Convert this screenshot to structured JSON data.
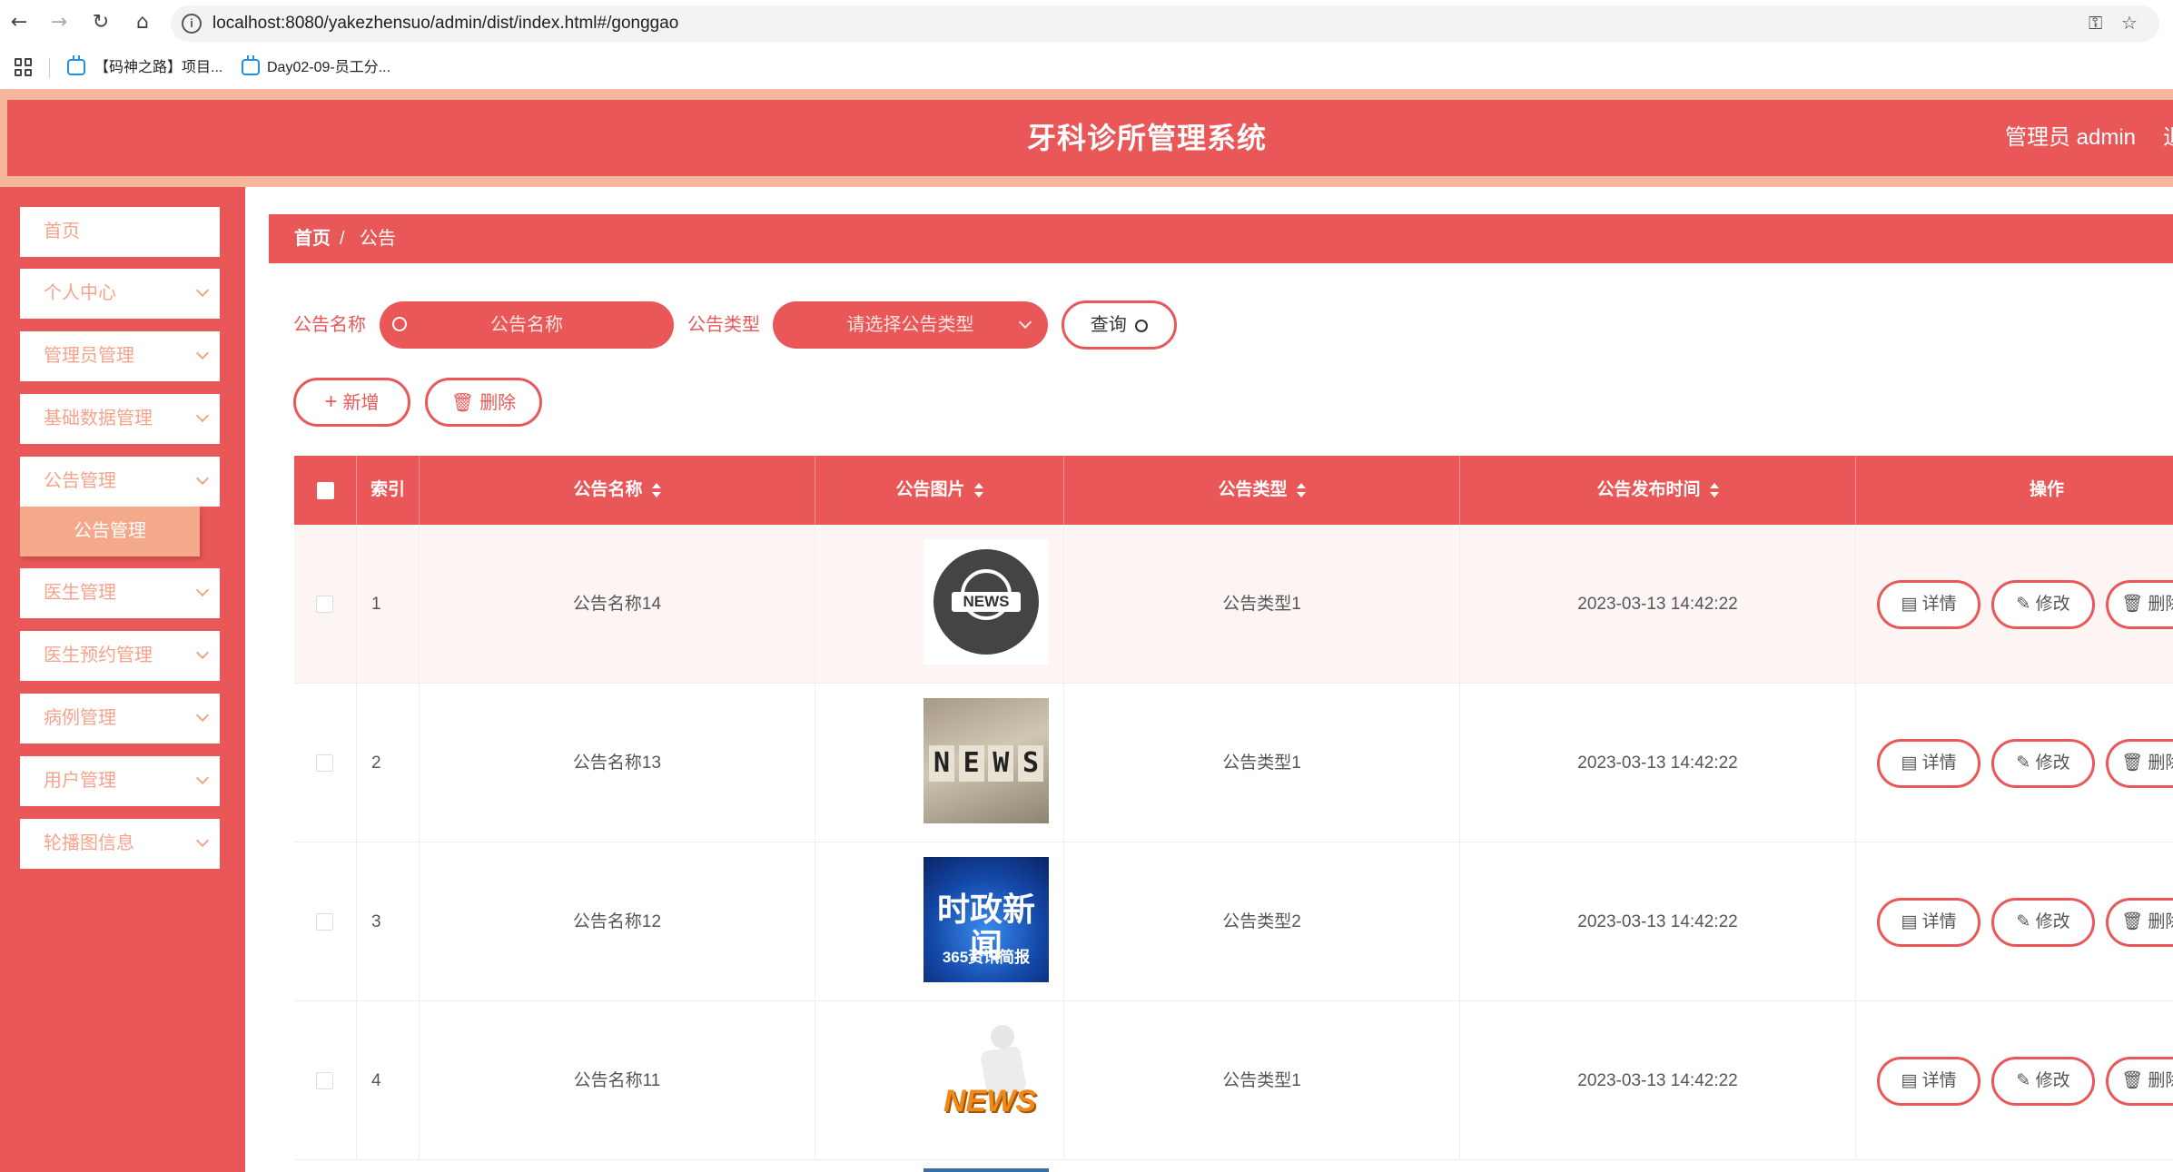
{
  "browser": {
    "url": "localhost:8080/yakezhensuo/admin/dist/index.html#/gonggao",
    "bookmarks": [
      "【码神之路】项目...",
      "Day02-09-员工分..."
    ]
  },
  "header": {
    "title": "牙科诊所管理系统",
    "user": "管理员 admin",
    "logout_partial": "退"
  },
  "sidebar": {
    "items": [
      {
        "label": "首页"
      },
      {
        "label": "个人中心"
      },
      {
        "label": "管理员管理"
      },
      {
        "label": "基础数据管理"
      },
      {
        "label": "公告管理"
      },
      {
        "label": "医生管理"
      },
      {
        "label": "医生预约管理"
      },
      {
        "label": "病例管理"
      },
      {
        "label": "用户管理"
      },
      {
        "label": "轮播图信息"
      }
    ],
    "active_sub": "公告管理"
  },
  "breadcrumb": {
    "home": "首页",
    "sep": "/",
    "current": "公告"
  },
  "search": {
    "name_label": "公告名称",
    "name_placeholder": "公告名称",
    "type_label": "公告类型",
    "type_placeholder": "请选择公告类型",
    "query_label": "查询"
  },
  "toolbar": {
    "add_label": "新增",
    "delete_label": "删除"
  },
  "table": {
    "headers": {
      "index": "索引",
      "name": "公告名称",
      "image": "公告图片",
      "type": "公告类型",
      "time": "公告发布时间",
      "ops": "操作"
    },
    "rows": [
      {
        "index": "1",
        "name": "公告名称14",
        "type": "公告类型1",
        "time": "2023-03-13 14:42:22",
        "image_text": "NEWS"
      },
      {
        "index": "2",
        "name": "公告名称13",
        "type": "公告类型1",
        "time": "2023-03-13 14:42:22",
        "image_text": "NEWS"
      },
      {
        "index": "3",
        "name": "公告名称12",
        "type": "公告类型2",
        "time": "2023-03-13 14:42:22",
        "image_text": "时政新闻",
        "image_sub": "365资讯简报"
      },
      {
        "index": "4",
        "name": "公告名称11",
        "type": "公告类型1",
        "time": "2023-03-13 14:42:22",
        "image_text": "NEWS"
      }
    ],
    "actions": {
      "detail": "详情",
      "edit": "修改",
      "delete_partial": "删除"
    }
  },
  "colors": {
    "primary": "#e95758",
    "peach": "#f5b89d",
    "submenu": "#f5a98b"
  }
}
